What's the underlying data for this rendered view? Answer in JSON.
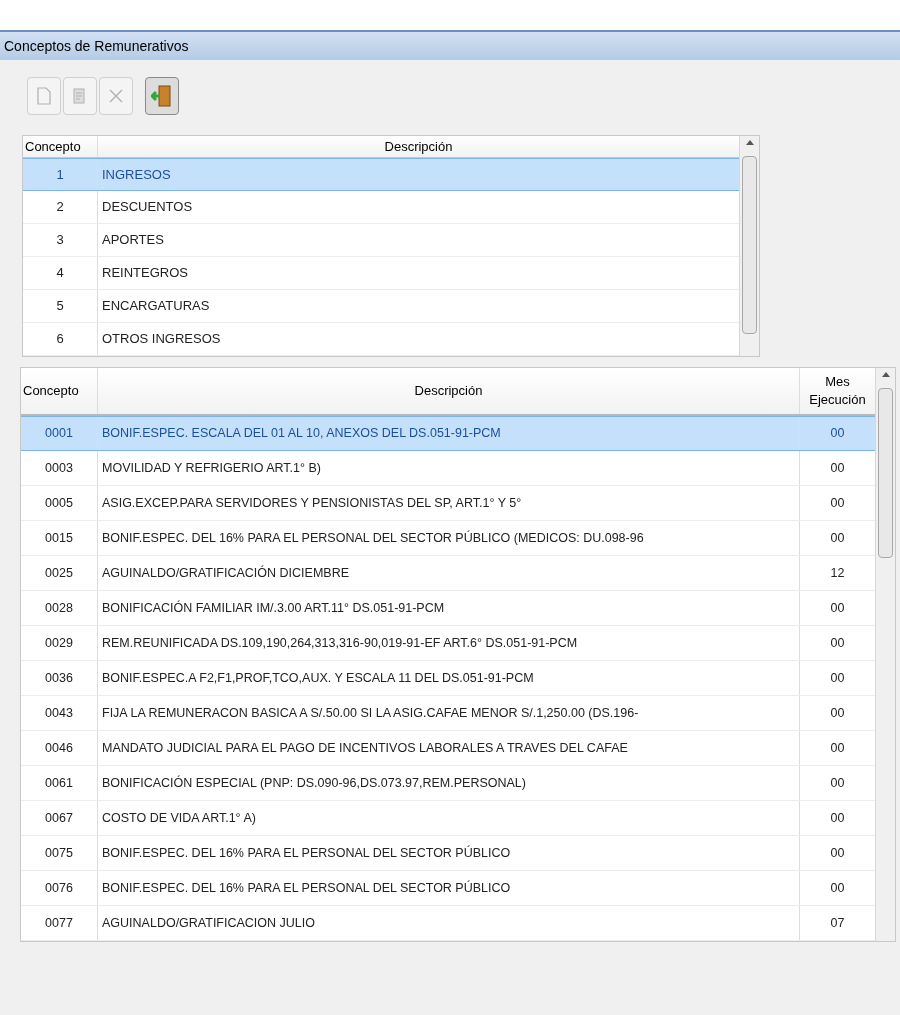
{
  "window": {
    "title": "Conceptos de Remunerativos"
  },
  "toolbar": [
    {
      "kind": "new",
      "disabled": true
    },
    {
      "kind": "edit",
      "disabled": true
    },
    {
      "kind": "delete",
      "disabled": true
    },
    {
      "kind": "exit",
      "disabled": false
    }
  ],
  "groups_table": {
    "columns": [
      "Concepto",
      "Descripción"
    ],
    "rows": [
      {
        "cells": [
          "1",
          "INGRESOS"
        ],
        "selected": true
      },
      {
        "cells": [
          "2",
          "DESCUENTOS"
        ],
        "selected": false
      },
      {
        "cells": [
          "3",
          "APORTES"
        ],
        "selected": false
      },
      {
        "cells": [
          "4",
          "REINTEGROS"
        ],
        "selected": false
      },
      {
        "cells": [
          "5",
          "ENCARGATURAS"
        ],
        "selected": false
      },
      {
        "cells": [
          "6",
          "OTROS INGRESOS"
        ],
        "selected": false
      }
    ]
  },
  "concepts_table": {
    "columns": [
      "Concepto",
      "Descripción",
      "Mes Ejecución"
    ],
    "rows": [
      {
        "cells": [
          "0001",
          "BONIF.ESPEC. ESCALA DEL 01 AL 10, ANEXOS DEL DS.051-91-PCM",
          "00"
        ],
        "selected": true
      },
      {
        "cells": [
          "0003",
          "MOVILIDAD Y REFRIGERIO ART.1° B)",
          "00"
        ],
        "selected": false
      },
      {
        "cells": [
          "0005",
          "ASIG.EXCEP.PARA SERVIDORES Y PENSIONISTAS DEL SP, ART.1° Y 5°",
          "00"
        ],
        "selected": false
      },
      {
        "cells": [
          "0015",
          "BONIF.ESPEC. DEL 16% PARA EL PERSONAL DEL SECTOR PÚBLICO (MEDICOS: DU.098-96",
          "00"
        ],
        "selected": false
      },
      {
        "cells": [
          "0025",
          "AGUINALDO/GRATIFICACIÓN DICIEMBRE",
          "12"
        ],
        "selected": false
      },
      {
        "cells": [
          "0028",
          "BONIFICACIÓN FAMILIAR IM/.3.00 ART.11° DS.051-91-PCM",
          "00"
        ],
        "selected": false
      },
      {
        "cells": [
          "0029",
          "REM.REUNIFICADA DS.109,190,264,313,316-90,019-91-EF ART.6° DS.051-91-PCM",
          "00"
        ],
        "selected": false
      },
      {
        "cells": [
          "0036",
          "BONIF.ESPEC.A F2,F1,PROF,TCO,AUX. Y ESCALA 11 DEL DS.051-91-PCM",
          "00"
        ],
        "selected": false
      },
      {
        "cells": [
          "0043",
          "FIJA LA REMUNERACON BASICA A S/.50.00 SI LA ASIG.CAFAE MENOR S/.1,250.00 (DS.196-",
          "00"
        ],
        "selected": false
      },
      {
        "cells": [
          "0046",
          "MANDATO JUDICIAL PARA EL PAGO DE INCENTIVOS LABORALES A TRAVES DEL CAFAE",
          "00"
        ],
        "selected": false
      },
      {
        "cells": [
          "0061",
          "BONIFICACIÓN ESPECIAL  (PNP: DS.090-96,DS.073.97,REM.PERSONAL)",
          "00"
        ],
        "selected": false
      },
      {
        "cells": [
          "0067",
          "COSTO DE VIDA ART.1° A)",
          "00"
        ],
        "selected": false
      },
      {
        "cells": [
          "0075",
          "BONIF.ESPEC. DEL 16% PARA EL PERSONAL DEL SECTOR PÚBLICO",
          "00"
        ],
        "selected": false
      },
      {
        "cells": [
          "0076",
          "BONIF.ESPEC. DEL 16% PARA EL PERSONAL DEL SECTOR PÚBLICO",
          "00"
        ],
        "selected": false
      },
      {
        "cells": [
          "0077",
          "AGUINALDO/GRATIFICACION JULIO",
          "07"
        ],
        "selected": false
      }
    ]
  }
}
